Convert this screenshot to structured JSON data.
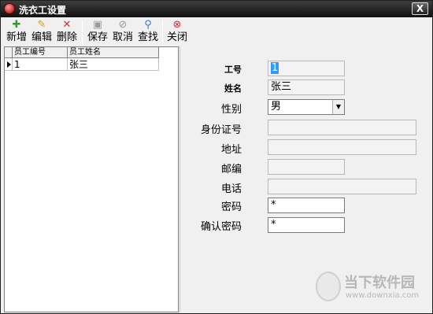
{
  "window": {
    "title": "洗衣工设置",
    "close_label": "X"
  },
  "toolbar": {
    "buttons": [
      {
        "label": "新增",
        "icon": "add-icon",
        "color": "#2e9d2e"
      },
      {
        "label": "编辑",
        "icon": "edit-icon",
        "color": "#d4a017"
      },
      {
        "label": "删除",
        "icon": "delete-icon",
        "color": "#d62b2b"
      },
      {
        "label": "保存",
        "icon": "save-icon",
        "color": "#9a9a9a"
      },
      {
        "label": "取消",
        "icon": "cancel-icon",
        "color": "#9a9a9a"
      },
      {
        "label": "查找",
        "icon": "find-icon",
        "color": "#3a7bd5"
      },
      {
        "label": "关闭",
        "icon": "close-icon",
        "color": "#d62b2b"
      }
    ]
  },
  "grid": {
    "columns": [
      "员工编号",
      "员工姓名"
    ],
    "rows": [
      {
        "id": "1",
        "name": "张三"
      }
    ]
  },
  "form": {
    "labels": {
      "id": "工号",
      "name": "姓名",
      "gender": "性别",
      "idcard": "身份证号",
      "address": "地址",
      "postcode": "邮编",
      "phone": "电话",
      "password": "密码",
      "confirm": "确认密码"
    },
    "values": {
      "id": "1",
      "name": "张三",
      "gender": "男",
      "idcard": "",
      "address": "",
      "postcode": "",
      "phone": "",
      "password": "*",
      "confirm": "*"
    }
  },
  "watermark": {
    "text": "当下软件园",
    "url": "www.downxia.com"
  }
}
